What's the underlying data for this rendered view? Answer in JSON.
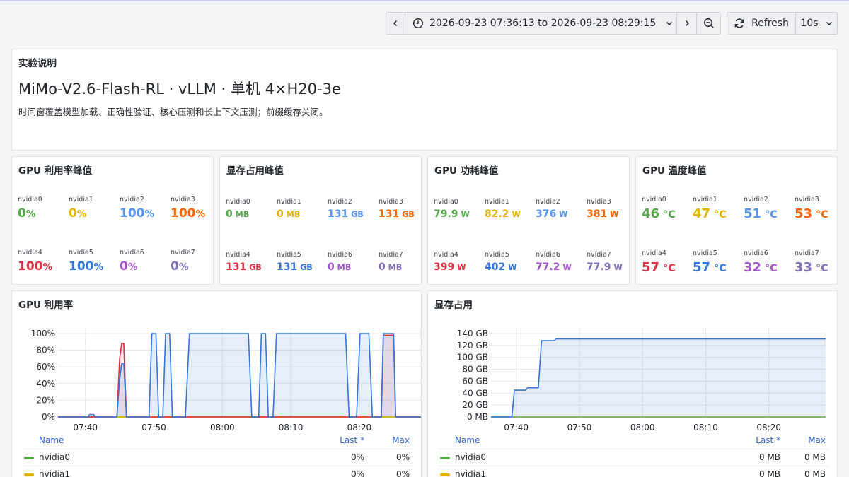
{
  "toolbar": {
    "time_range": "2026-09-23 07:36:13 to 2026-09-23 08:29:15",
    "refresh_label": "Refresh",
    "interval": "10s"
  },
  "text_panel": {
    "title": "实验说明",
    "heading": "MiMo-V2.6-Flash-RL · vLLM · 单机 4×H20-3e",
    "description": "时间窗覆盖模型加载、正确性验证、核心压测和长上下文压测；前缀缓存关闭。"
  },
  "stat_panels": [
    {
      "title": "GPU 利用率峰值",
      "items": [
        {
          "label": "nvidia0",
          "value": "0",
          "unit": "%",
          "color": "#56a64b"
        },
        {
          "label": "nvidia1",
          "value": "0",
          "unit": "%",
          "color": "#e0b400"
        },
        {
          "label": "nvidia2",
          "value": "100",
          "unit": "%",
          "color": "#5794f2"
        },
        {
          "label": "nvidia3",
          "value": "100",
          "unit": "%",
          "color": "#fa6400"
        },
        {
          "label": "nvidia4",
          "value": "100",
          "unit": "%",
          "color": "#e02f44"
        },
        {
          "label": "nvidia5",
          "value": "100",
          "unit": "%",
          "color": "#3274d9"
        },
        {
          "label": "nvidia6",
          "value": "0",
          "unit": "%",
          "color": "#a352cc"
        },
        {
          "label": "nvidia7",
          "value": "0",
          "unit": "%",
          "color": "#806eb7"
        }
      ]
    },
    {
      "title": "显存占用峰值",
      "items": [
        {
          "label": "nvidia0",
          "value": "0",
          "unit": " MB",
          "color": "#56a64b"
        },
        {
          "label": "nvidia1",
          "value": "0",
          "unit": " MB",
          "color": "#e0b400"
        },
        {
          "label": "nvidia2",
          "value": "131",
          "unit": " GB",
          "color": "#5794f2"
        },
        {
          "label": "nvidia3",
          "value": "131",
          "unit": " GB",
          "color": "#fa6400"
        },
        {
          "label": "nvidia4",
          "value": "131",
          "unit": " GB",
          "color": "#e02f44"
        },
        {
          "label": "nvidia5",
          "value": "131",
          "unit": " GB",
          "color": "#3274d9"
        },
        {
          "label": "nvidia6",
          "value": "0",
          "unit": " MB",
          "color": "#a352cc"
        },
        {
          "label": "nvidia7",
          "value": "0",
          "unit": " MB",
          "color": "#806eb7"
        }
      ]
    },
    {
      "title": "GPU 功耗峰值",
      "items": [
        {
          "label": "nvidia0",
          "value": "79.9",
          "unit": " W",
          "color": "#56a64b"
        },
        {
          "label": "nvidia1",
          "value": "82.2",
          "unit": " W",
          "color": "#e0b400"
        },
        {
          "label": "nvidia2",
          "value": "376",
          "unit": " W",
          "color": "#5794f2"
        },
        {
          "label": "nvidia3",
          "value": "381",
          "unit": " W",
          "color": "#fa6400"
        },
        {
          "label": "nvidia4",
          "value": "399",
          "unit": " W",
          "color": "#e02f44"
        },
        {
          "label": "nvidia5",
          "value": "402",
          "unit": " W",
          "color": "#3274d9"
        },
        {
          "label": "nvidia6",
          "value": "77.2",
          "unit": " W",
          "color": "#a352cc"
        },
        {
          "label": "nvidia7",
          "value": "77.9",
          "unit": " W",
          "color": "#806eb7"
        }
      ]
    },
    {
      "title": "GPU 温度峰值",
      "items": [
        {
          "label": "nvidia0",
          "value": "46",
          "unit": " °C",
          "color": "#56a64b"
        },
        {
          "label": "nvidia1",
          "value": "47",
          "unit": " °C",
          "color": "#e0b400"
        },
        {
          "label": "nvidia2",
          "value": "51",
          "unit": " °C",
          "color": "#5794f2"
        },
        {
          "label": "nvidia3",
          "value": "53",
          "unit": " °C",
          "color": "#fa6400"
        },
        {
          "label": "nvidia4",
          "value": "57",
          "unit": " °C",
          "color": "#e02f44"
        },
        {
          "label": "nvidia5",
          "value": "57",
          "unit": " °C",
          "color": "#3274d9"
        },
        {
          "label": "nvidia6",
          "value": "32",
          "unit": " °C",
          "color": "#a352cc"
        },
        {
          "label": "nvidia7",
          "value": "33",
          "unit": " °C",
          "color": "#806eb7"
        }
      ]
    }
  ],
  "chart_data": [
    {
      "type": "area",
      "title": "GPU 利用率",
      "x_ticks": [
        "07:40",
        "07:50",
        "08:00",
        "08:10",
        "08:20"
      ],
      "y_ticks": [
        "0%",
        "20%",
        "40%",
        "60%",
        "80%",
        "100%"
      ],
      "ylim": [
        0,
        100
      ],
      "x_range": [
        "07:36",
        "08:29"
      ],
      "legend_headers": [
        "Name",
        "Last *",
        "Max"
      ],
      "legend": [
        {
          "name": "nvidia0",
          "last": "0%",
          "max": "0%",
          "color": "#56a64b"
        },
        {
          "name": "nvidia1",
          "last": "0%",
          "max": "0%",
          "color": "#e0b400"
        }
      ],
      "series": [
        {
          "name": "nvidia0",
          "color": "#56a64b",
          "points": [
            [
              "07:36",
              0
            ],
            [
              "08:29",
              0
            ]
          ]
        },
        {
          "name": "nvidia1",
          "color": "#e0b400",
          "points": [
            [
              "07:36",
              0
            ],
            [
              "08:29",
              0
            ]
          ]
        },
        {
          "name": "nvidia4",
          "color": "#e02f44",
          "points": [
            [
              "07:36",
              0
            ],
            [
              "07:44.6",
              0
            ],
            [
              "07:45",
              70
            ],
            [
              "07:45.3",
              88
            ],
            [
              "07:45.6",
              88
            ],
            [
              "07:46",
              0
            ],
            [
              "08:23.2",
              0
            ],
            [
              "08:23.5",
              98
            ],
            [
              "08:25",
              98
            ],
            [
              "08:25.3",
              0
            ],
            [
              "08:29",
              0
            ]
          ]
        },
        {
          "name": "nvidia5",
          "color": "#3274d9",
          "points": [
            [
              "07:36",
              0
            ],
            [
              "07:40.4",
              0
            ],
            [
              "07:40.6",
              3
            ],
            [
              "07:41.2",
              3
            ],
            [
              "07:41.4",
              0
            ],
            [
              "07:44.6",
              0
            ],
            [
              "07:45",
              45
            ],
            [
              "07:45.3",
              64
            ],
            [
              "07:45.6",
              64
            ],
            [
              "07:46",
              0
            ],
            [
              "07:49.3",
              0
            ],
            [
              "07:49.7",
              100
            ],
            [
              "07:50.3",
              100
            ],
            [
              "07:50.7",
              0
            ],
            [
              "07:51.3",
              0
            ],
            [
              "07:51.7",
              100
            ],
            [
              "07:52.3",
              100
            ],
            [
              "07:52.7",
              0
            ],
            [
              "07:54.6",
              0
            ],
            [
              "07:55.2",
              100
            ],
            [
              "08:03.8",
              100
            ],
            [
              "08:04.3",
              0
            ],
            [
              "08:05.3",
              0
            ],
            [
              "08:05.7",
              100
            ],
            [
              "08:06.3",
              100
            ],
            [
              "08:06.7",
              0
            ],
            [
              "08:07.4",
              0
            ],
            [
              "08:07.9",
              100
            ],
            [
              "08:18",
              100
            ],
            [
              "08:18.5",
              0
            ],
            [
              "08:19.6",
              0
            ],
            [
              "08:20.1",
              100
            ],
            [
              "08:21.4",
              100
            ],
            [
              "08:21.9",
              0
            ],
            [
              "08:23.2",
              0
            ],
            [
              "08:23.5",
              100
            ],
            [
              "08:25",
              100
            ],
            [
              "08:25.3",
              0
            ],
            [
              "08:29",
              0
            ]
          ]
        }
      ]
    },
    {
      "type": "area",
      "title": "显存占用",
      "x_ticks": [
        "07:40",
        "07:50",
        "08:00",
        "08:10",
        "08:20"
      ],
      "y_ticks": [
        "0 MB",
        "20 GB",
        "40 GB",
        "60 GB",
        "80 GB",
        "100 GB",
        "120 GB",
        "140 GB"
      ],
      "ylim": [
        0,
        140
      ],
      "x_range": [
        "07:36",
        "08:29"
      ],
      "legend_headers": [
        "Name",
        "Last *",
        "Max"
      ],
      "legend": [
        {
          "name": "nvidia0",
          "last": "0 MB",
          "max": "0 MB",
          "color": "#56a64b"
        },
        {
          "name": "nvidia1",
          "last": "0 MB",
          "max": "0 MB",
          "color": "#e0b400"
        }
      ],
      "series": [
        {
          "name": "nvidia0",
          "color": "#56a64b",
          "points": [
            [
              "07:36",
              0
            ],
            [
              "08:29",
              0
            ]
          ]
        },
        {
          "name": "nvidia5",
          "color": "#3274d9",
          "points": [
            [
              "07:36",
              0
            ],
            [
              "07:39.3",
              0
            ],
            [
              "07:39.7",
              45
            ],
            [
              "07:41.5",
              45
            ],
            [
              "07:41.8",
              49
            ],
            [
              "07:43.5",
              49
            ],
            [
              "07:44",
              128
            ],
            [
              "07:46",
              128
            ],
            [
              "07:46.3",
              131
            ],
            [
              "08:29",
              131
            ]
          ]
        }
      ]
    }
  ]
}
